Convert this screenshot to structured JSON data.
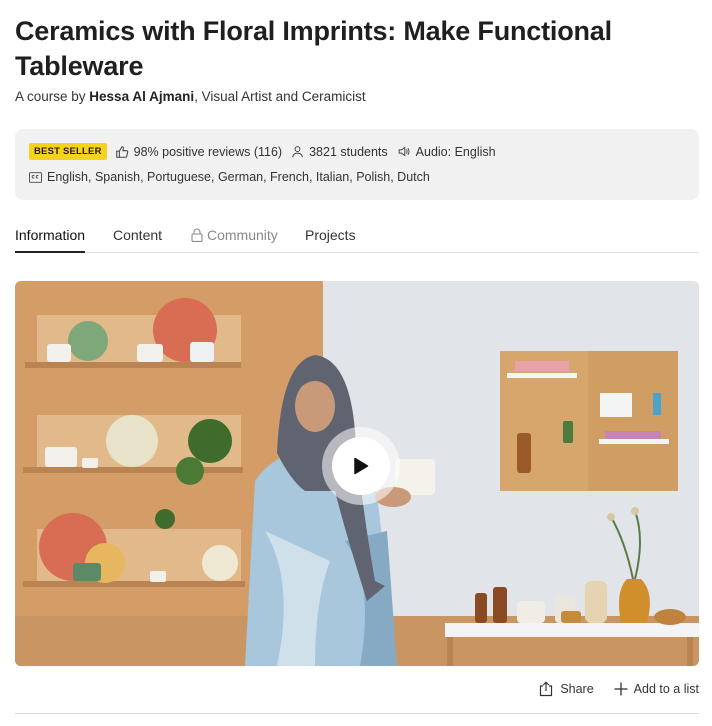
{
  "course": {
    "title": "Ceramics with Floral Imprints: Make Functional Tableware",
    "byline_prefix": "A course by ",
    "author": "Hessa Al Ajmani",
    "author_role": ", Visual Artist and Ceramicist"
  },
  "stats": {
    "badge": "BEST SELLER",
    "reviews": "98% positive reviews (116)",
    "students": "3821 students",
    "audio": "Audio: English",
    "subtitles": "English, Spanish, Portuguese, German, French, Italian, Polish, Dutch"
  },
  "tabs": [
    {
      "label": "Information",
      "active": true
    },
    {
      "label": "Content"
    },
    {
      "label": "Community",
      "locked": true
    },
    {
      "label": "Projects"
    }
  ],
  "actions": {
    "share": "Share",
    "add_to_list": "Add to a list"
  },
  "colors": {
    "badge_bg": "#f7d21c",
    "orange_wall": "#d9a06b",
    "grey_wall": "#dfe2e6"
  },
  "icons": [
    "thumbs-up-icon",
    "user-icon",
    "speaker-icon",
    "cc-icon",
    "lock-icon",
    "play-icon",
    "share-icon",
    "plus-icon"
  ]
}
